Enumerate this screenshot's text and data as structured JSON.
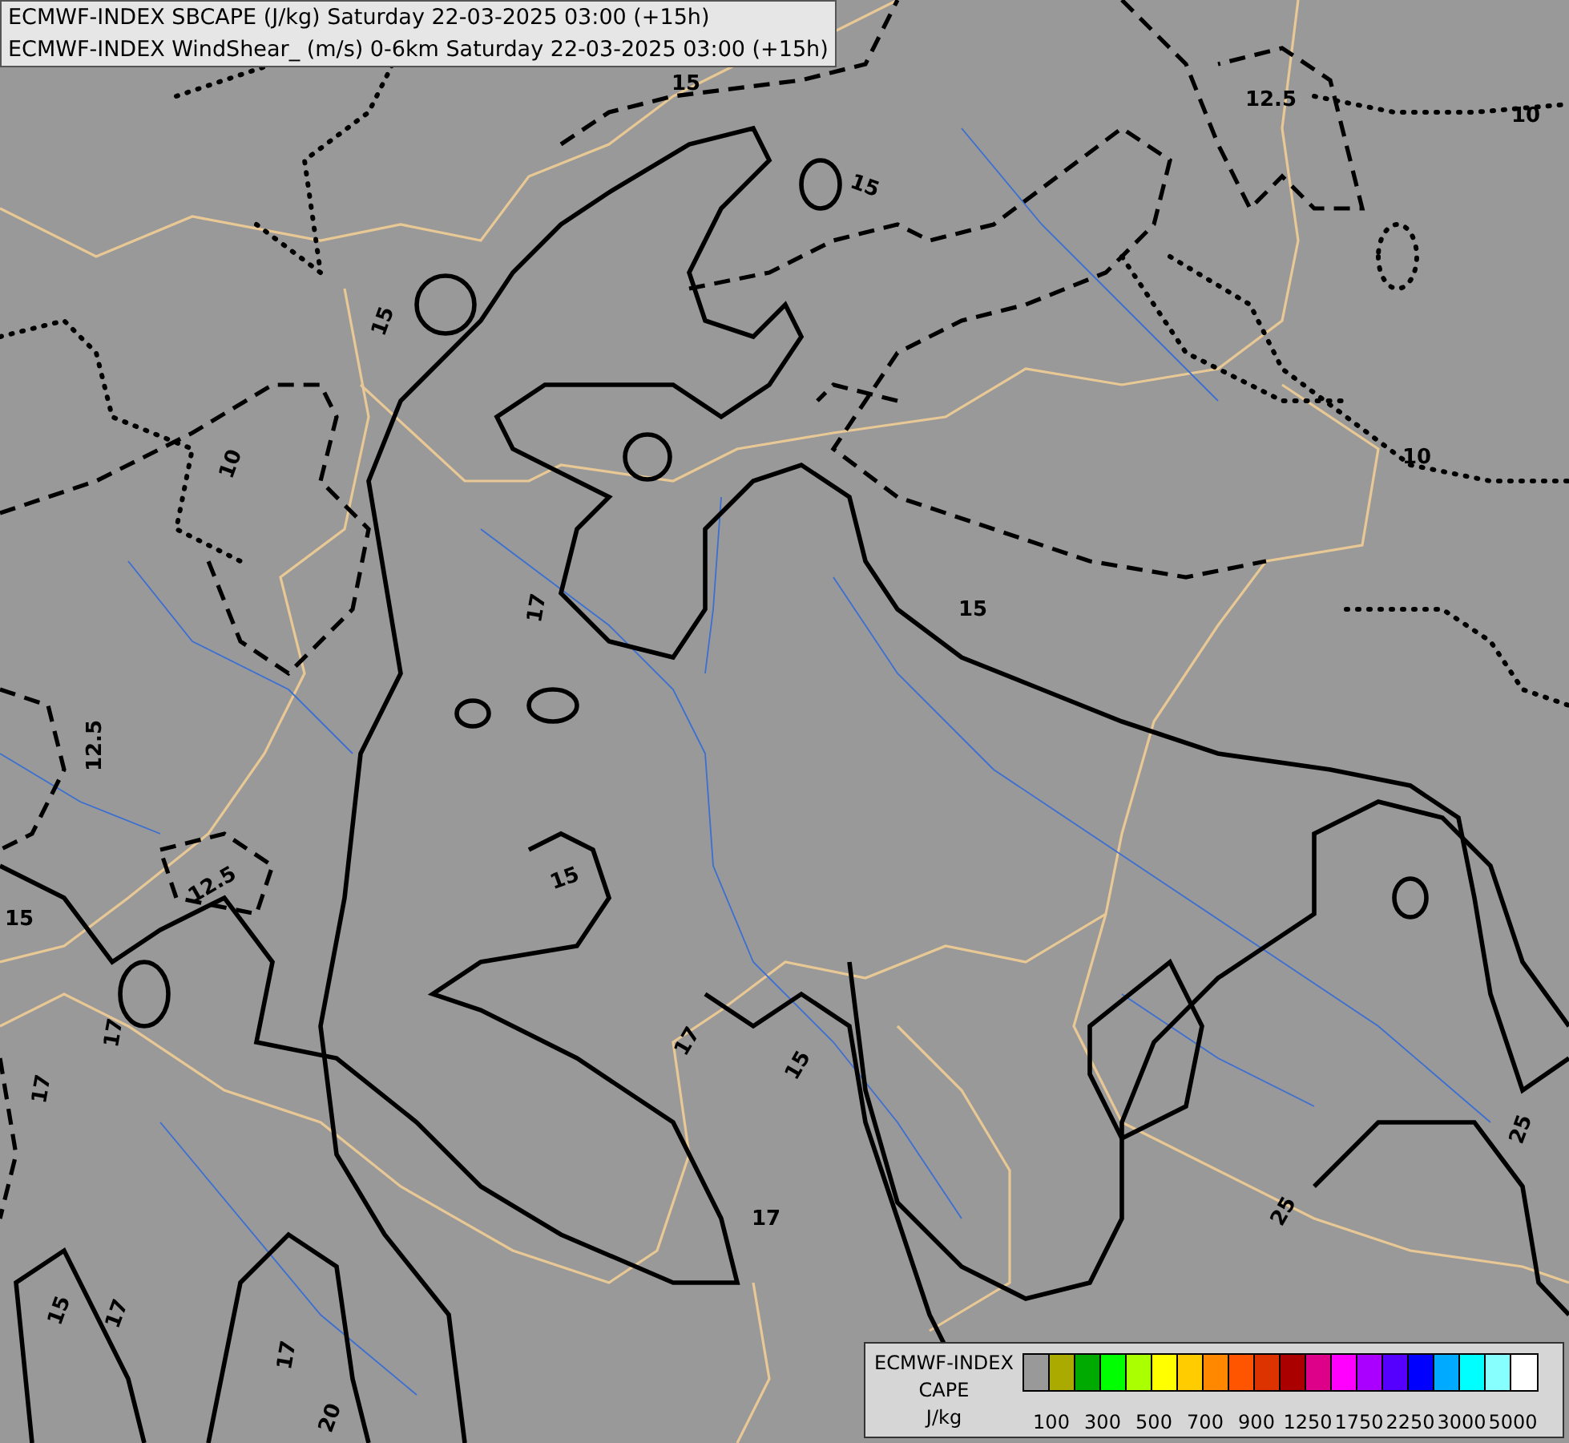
{
  "title_lines": [
    "ECMWF-INDEX SBCAPE (J/kg) Saturday 22-03-2025 03:00 (+15h)",
    "ECMWF-INDEX WindShear_ (m/s) 0-6km Saturday 22-03-2025 03:00 (+15h)"
  ],
  "contour_labels": [
    "15",
    "12.5",
    "10",
    "15",
    "15",
    "10",
    "10",
    "17",
    "15",
    "12.5",
    "12.5",
    "15",
    "15",
    "17",
    "17",
    "17",
    "15",
    "17",
    "25",
    "25",
    "15",
    "17",
    "17",
    "20"
  ],
  "legend": {
    "title_lines": [
      "ECMWF-INDEX",
      "CAPE",
      "J/kg"
    ],
    "swatches": [
      {
        "color": "#999999"
      },
      {
        "color": "#aaaa00"
      },
      {
        "color": "#00aa00"
      },
      {
        "color": "#00ff00"
      },
      {
        "color": "#aaff00"
      },
      {
        "color": "#ffff00"
      },
      {
        "color": "#ffcc00"
      },
      {
        "color": "#ff8800"
      },
      {
        "color": "#ff5500"
      },
      {
        "color": "#dd3300"
      },
      {
        "color": "#aa0000"
      },
      {
        "color": "#dd0088"
      },
      {
        "color": "#ff00ff"
      },
      {
        "color": "#aa00ff"
      },
      {
        "color": "#5500ff"
      },
      {
        "color": "#0000ff"
      },
      {
        "color": "#00aaff"
      },
      {
        "color": "#00ffff"
      },
      {
        "color": "#88ffff"
      },
      {
        "color": "#ffffff"
      }
    ],
    "ticks": [
      "100",
      "300",
      "500",
      "700",
      "900",
      "1250",
      "1750",
      "2250",
      "3000",
      "5000"
    ]
  }
}
